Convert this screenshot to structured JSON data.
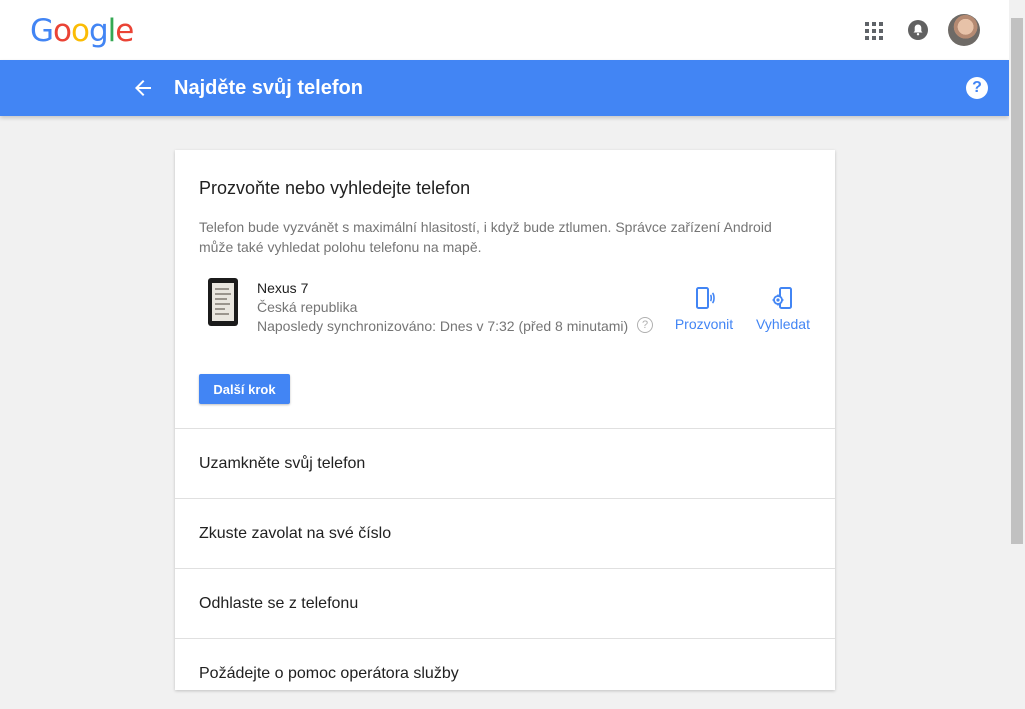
{
  "header": {
    "logo_letters": [
      {
        "char": "G",
        "color": "#4285f4"
      },
      {
        "char": "o",
        "color": "#ea4335"
      },
      {
        "char": "o",
        "color": "#fbbc05"
      },
      {
        "char": "g",
        "color": "#4285f4"
      },
      {
        "char": "l",
        "color": "#34a853"
      },
      {
        "char": "e",
        "color": "#ea4335"
      }
    ],
    "icons": [
      "apps-grid-icon",
      "notifications-bell-icon",
      "avatar"
    ]
  },
  "titlebar": {
    "title": "Najděte svůj telefon",
    "background_color": "#4285f4",
    "back_icon": "arrow-back-icon",
    "help_icon": "?"
  },
  "card": {
    "title": "Prozvoňte nebo vyhledejte telefon",
    "description": "Telefon bude vyzvánět s maximální hlasitostí, i když bude ztlumen. Správce zařízení Android může také vyhledat polohu telefonu na mapě.",
    "device": {
      "name": "Nexus 7",
      "country": "Česká republika",
      "sync": "Naposledy synchronizováno: Dnes v 7:32 (před 8 minutami)",
      "info_icon": "?"
    },
    "actions": {
      "ring": {
        "label": "Prozvonit",
        "icon": "phone-ring-icon"
      },
      "locate": {
        "label": "Vyhledat",
        "icon": "phone-locate-icon"
      }
    },
    "next_button": "Další krok",
    "options": [
      "Uzamkněte svůj telefon",
      "Zkuste zavolat na své číslo",
      "Odhlaste se z telefonu",
      "Požádejte o pomoc operátora služby"
    ]
  },
  "accent_color": "#4285f4"
}
